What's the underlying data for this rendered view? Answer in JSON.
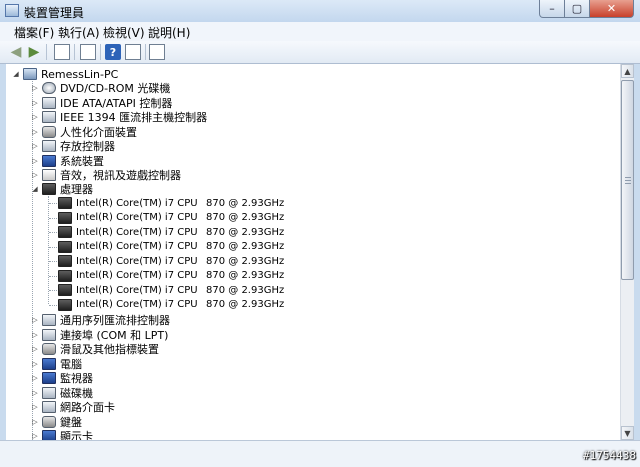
{
  "window": {
    "title": "裝置管理員",
    "min_label": "–",
    "max_label": "▢",
    "close_label": "✕"
  },
  "menu": [
    {
      "label": "檔案(F)"
    },
    {
      "label": "執行(A)"
    },
    {
      "label": "檢視(V)"
    },
    {
      "label": "說明(H)"
    }
  ],
  "toolbar": {
    "back_icon": "back-arrow-icon",
    "forward_icon": "forward-arrow-icon",
    "back_glyph": "◀",
    "forward_glyph": "▶",
    "help_glyph": "?"
  },
  "tree": {
    "root": {
      "label": "RemessLin-PC",
      "expander": "◢"
    },
    "categories_before": [
      {
        "label": "DVD/CD-ROM 光碟機",
        "icon": "disc"
      },
      {
        "label": "IDE ATA/ATAPI 控制器",
        "icon": "box"
      },
      {
        "label": "IEEE 1394 匯流排主機控制器",
        "icon": "box"
      },
      {
        "label": "人性化介面裝置",
        "icon": "hid"
      },
      {
        "label": "存放控制器",
        "icon": "box"
      },
      {
        "label": "系統裝置",
        "icon": "screen"
      },
      {
        "label": "音效，視訊及遊戲控制器",
        "icon": "sound"
      }
    ],
    "processor": {
      "label": "處理器",
      "expander": "◢"
    },
    "cpus": [
      {
        "name": "Intel(R) Core(TM) i7 CPU",
        "speed": "870 @ 2.93GHz"
      },
      {
        "name": "Intel(R) Core(TM) i7 CPU",
        "speed": "870 @ 2.93GHz"
      },
      {
        "name": "Intel(R) Core(TM) i7 CPU",
        "speed": "870 @ 2.93GHz"
      },
      {
        "name": "Intel(R) Core(TM) i7 CPU",
        "speed": "870 @ 2.93GHz"
      },
      {
        "name": "Intel(R) Core(TM) i7 CPU",
        "speed": "870 @ 2.93GHz"
      },
      {
        "name": "Intel(R) Core(TM) i7 CPU",
        "speed": "870 @ 2.93GHz"
      },
      {
        "name": "Intel(R) Core(TM) i7 CPU",
        "speed": "870 @ 2.93GHz"
      },
      {
        "name": "Intel(R) Core(TM) i7 CPU",
        "speed": "870 @ 2.93GHz"
      }
    ],
    "categories_after": [
      {
        "label": "通用序列匯流排控制器",
        "icon": "box"
      },
      {
        "label": "連接埠 (COM 和 LPT)",
        "icon": "box"
      },
      {
        "label": "滑鼠及其他指標裝置",
        "icon": "hid"
      },
      {
        "label": "電腦",
        "icon": "screen"
      },
      {
        "label": "監視器",
        "icon": "screen"
      },
      {
        "label": "磁碟機",
        "icon": "box"
      },
      {
        "label": "網路介面卡",
        "icon": "box"
      },
      {
        "label": "鍵盤",
        "icon": "hid"
      },
      {
        "label": "顯示卡",
        "icon": "screen"
      }
    ],
    "collapsed_glyph": "▷"
  },
  "scrollbar": {
    "up_glyph": "▲",
    "down_glyph": "▼"
  },
  "watermark": "#1754438"
}
